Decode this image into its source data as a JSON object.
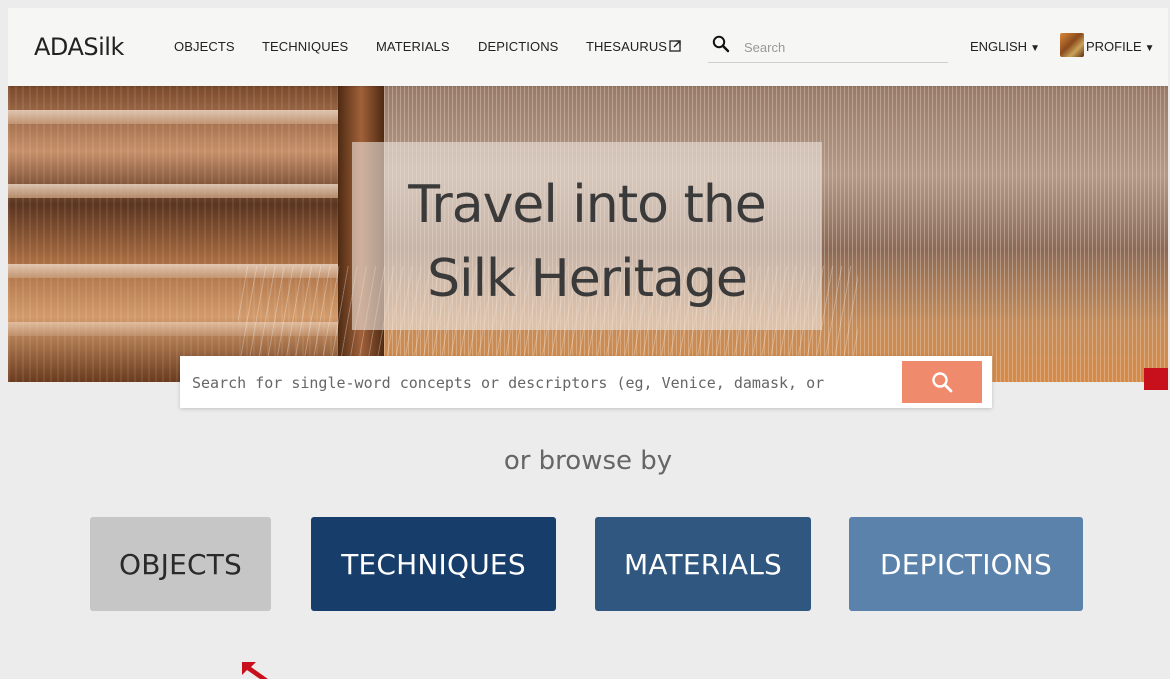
{
  "brand": "ADASilk",
  "nav": {
    "links": [
      {
        "label": "OBJECTS"
      },
      {
        "label": "TECHNIQUES"
      },
      {
        "label": "MATERIALS"
      },
      {
        "label": "DEPICTIONS"
      },
      {
        "label": "THESAURUS"
      }
    ],
    "search_placeholder": "Search",
    "language": "ENGLISH",
    "profile": "PROFILE"
  },
  "hero": {
    "title_line1": "Travel into the",
    "title_line2": "Silk Heritage"
  },
  "main_search": {
    "placeholder": "Search for single-word concepts or descriptors (eg, Venice, damask, or"
  },
  "browse": {
    "label": "or browse by",
    "buttons": [
      {
        "label": "OBJECTS",
        "bg": "#c6c6c6",
        "fg": "#2a2a2a"
      },
      {
        "label": "TECHNIQUES",
        "bg": "#173d6b",
        "fg": "#ffffff"
      },
      {
        "label": "MATERIALS",
        "bg": "#2f577f",
        "fg": "#ffffff"
      },
      {
        "label": "DEPICTIONS",
        "bg": "#5a82ab",
        "fg": "#ffffff"
      }
    ]
  },
  "colors": {
    "accent_search": "#f08a6c",
    "annotation_red": "#c8101c"
  }
}
